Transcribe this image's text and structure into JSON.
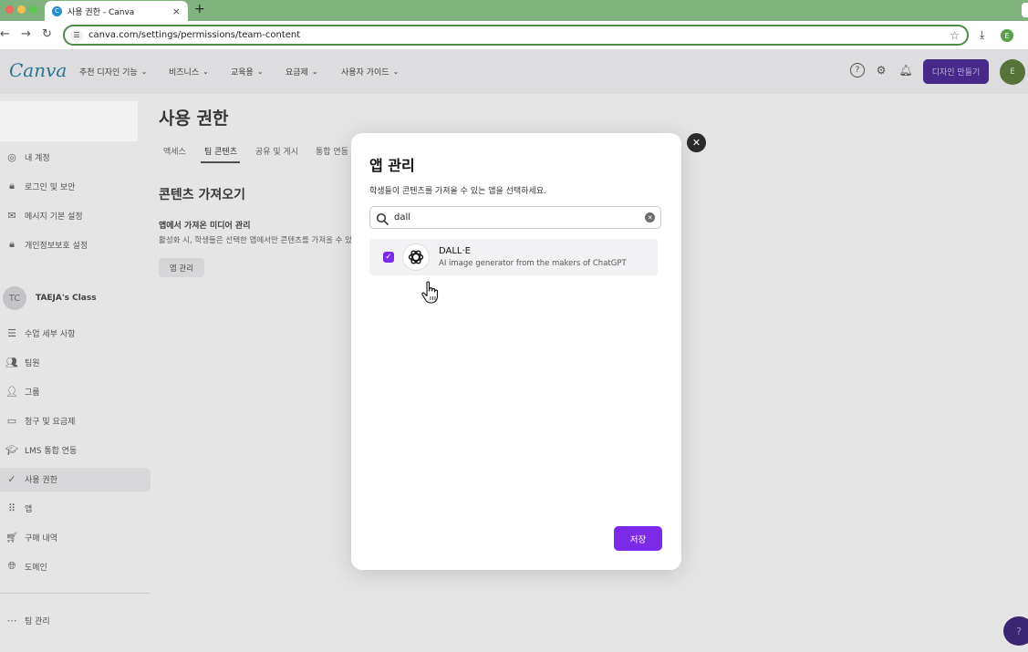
{
  "browser": {
    "tab_title": "사용 권한 - Canva",
    "favicon_letter": "C",
    "tab_close": "×",
    "new_tab": "+",
    "url": "canva.com/settings/permissions/team-content",
    "profile_initial": "E"
  },
  "header": {
    "logo": "Canva",
    "menus": [
      "추천 디자인 기능",
      "비즈니스",
      "교육용",
      "요금제",
      "사용자 가이드"
    ],
    "create_button": "디자인 만들기",
    "avatar_text": "E"
  },
  "sidebar": {
    "account_items": [
      "내 계정",
      "로그인 및 보안",
      "메시지 기본 설정",
      "개인정보보호 설정"
    ],
    "team_avatar": "TC",
    "team_name": "TAEJA's Class",
    "team_items": [
      "수업 세부 사항",
      "팀원",
      "그룹",
      "청구 및 요금제",
      "LMS 통합 연동",
      "사용 권한",
      "앱",
      "구매 내역",
      "도메인"
    ],
    "active_item": "사용 권한",
    "footer_item": "팀 관리"
  },
  "main": {
    "title": "사용 권한",
    "tabs": [
      "액세스",
      "팀 콘텐츠",
      "공유 및 게시",
      "통합 연동"
    ],
    "active_tab": "팀 콘텐츠",
    "section_title": "콘텐츠 가져오기",
    "sub_title": "앱에서 가져온 미디어 관리",
    "sub_desc": "활성화 시, 학생들은 선택한 앱에서만 콘텐츠를 가져올 수 있",
    "manage_button": "앱 관리"
  },
  "modal": {
    "title": "앱 관리",
    "description": "학생들이 콘텐츠를 가져올 수 있는 앱을 선택하세요.",
    "search_value": "dall",
    "apps": [
      {
        "name": "DALL·E",
        "description": "AI image generator from the makers of ChatGPT",
        "checked": true
      }
    ],
    "save_button": "저장",
    "close_glyph": "✕"
  },
  "help_fab": "?",
  "colors": {
    "accent": "#7d2ae8",
    "browser_tabstrip": "#7fb27c",
    "create_button": "#4a2c91"
  }
}
